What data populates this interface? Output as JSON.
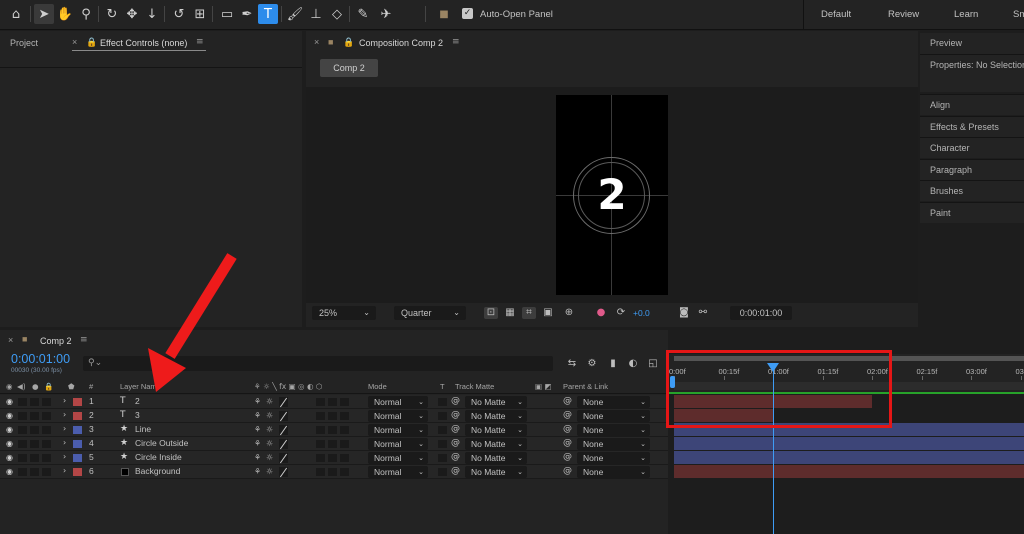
{
  "toolbar": {
    "tools": [
      "home-icon",
      "selection-icon",
      "hand-icon",
      "zoom-icon",
      "orbit-icon",
      "pan-icon",
      "dolly-icon",
      "rotate-icon",
      "anchor-icon",
      "rectangle-icon",
      "pen-icon",
      "type-icon",
      "brush-icon",
      "clone-stamp-icon",
      "eraser-icon",
      "roto-brush-icon",
      "puppet-pin-icon"
    ],
    "auto_open_checked": true,
    "auto_open_label": "Auto-Open Panel",
    "workspaces": [
      "Default",
      "Review",
      "Learn",
      "Sm"
    ]
  },
  "left_panel": {
    "tabs": [
      "Project",
      "Effect Controls (none)"
    ]
  },
  "viewer": {
    "tab": "Composition Comp 2",
    "comp_button": "Comp 2",
    "frame_number": "2",
    "zoom": "25%",
    "resolution": "Quarter",
    "exposure": "+0.0",
    "timecode": "0:00:01:00"
  },
  "right_panels": {
    "preview": "Preview",
    "properties": "Properties: No Selection",
    "items": [
      "Align",
      "Effects & Presets",
      "Character",
      "Paragraph",
      "Brushes",
      "Paint"
    ]
  },
  "timeline": {
    "tab": "Comp 2",
    "timecode": "0:00:01:00",
    "fps": "00030 (30.00 fps)",
    "search_placeholder": "",
    "columns": {
      "num": "#",
      "layer_name": "Layer Name",
      "mode": "Mode",
      "t": "T",
      "track_matte": "Track Matte",
      "parent": "Parent & Link"
    },
    "ruler_ticks": [
      "0:00f",
      "00:15f",
      "01:00f",
      "01:15f",
      "02:00f",
      "02:15f",
      "03:00f",
      "03:"
    ],
    "playhead_time_seconds": 1.0,
    "layers": [
      {
        "num": "1",
        "name": "2",
        "type": "text",
        "color": "#b34646",
        "mode": "Normal",
        "matte": "No Matte",
        "parent": "None",
        "bar_color": "#5e2c2c",
        "bar_start_s": 0.0,
        "bar_end_s": 2.0
      },
      {
        "num": "2",
        "name": "3",
        "type": "text",
        "color": "#b34646",
        "mode": "Normal",
        "matte": "No Matte",
        "parent": "None",
        "bar_color": "#5e2c2c",
        "bar_start_s": 0.0,
        "bar_end_s": 1.0
      },
      {
        "num": "3",
        "name": "Line",
        "type": "shape",
        "color": "#4b5dad",
        "mode": "Normal",
        "matte": "No Matte",
        "parent": "None",
        "bar_color": "#3d4578",
        "bar_start_s": 0.0,
        "bar_end_s": 7.5
      },
      {
        "num": "4",
        "name": "Circle Outside",
        "type": "shape",
        "color": "#4b5dad",
        "mode": "Normal",
        "matte": "No Matte",
        "parent": "None",
        "bar_color": "#3d4578",
        "bar_start_s": 0.0,
        "bar_end_s": 7.5
      },
      {
        "num": "5",
        "name": "Circle Inside",
        "type": "shape",
        "color": "#4b5dad",
        "mode": "Normal",
        "matte": "No Matte",
        "parent": "None",
        "bar_color": "#3d4578",
        "bar_start_s": 0.0,
        "bar_end_s": 7.5
      },
      {
        "num": "6",
        "name": "Background",
        "type": "solid",
        "color": "#b34646",
        "mode": "Normal",
        "matte": "No Matte",
        "parent": "None",
        "bar_color": "#5e2c2c",
        "bar_start_s": 0.0,
        "bar_end_s": 7.5
      }
    ]
  },
  "annotations": {
    "arrow_color": "#ee1b1b",
    "highlight_box_color": "#e51616"
  }
}
